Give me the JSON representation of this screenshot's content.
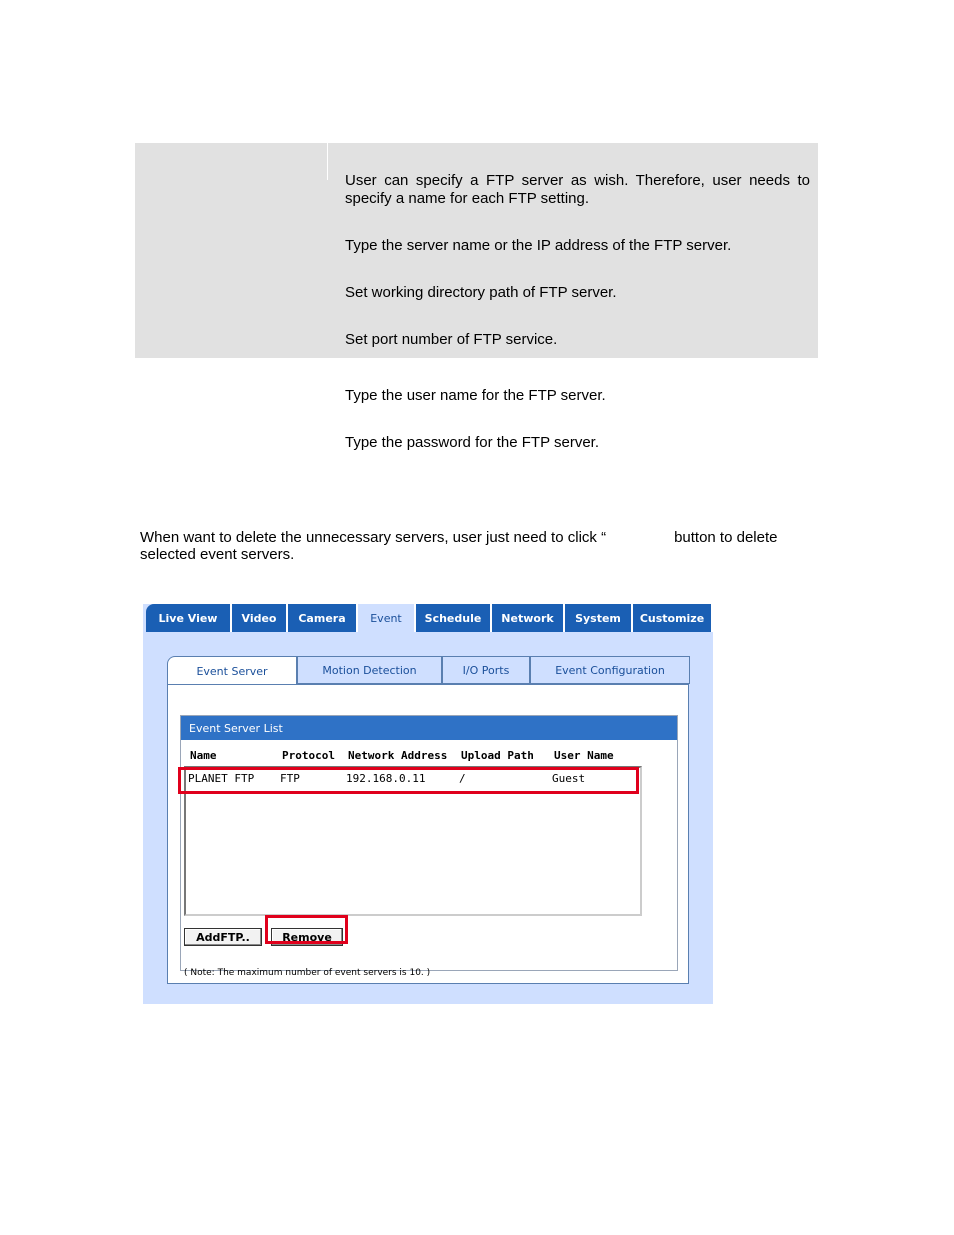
{
  "descriptions": [
    "User can specify a FTP server as wish. Therefore, user needs to specify a name for each FTP setting.",
    "Type the server name or the IP address of the FTP server.",
    "Set working directory path of FTP server.",
    "Set port number of FTP service.",
    "Type the user name for the FTP server.",
    "Type the password for the FTP server."
  ],
  "paragraph": {
    "line1a": "When want to delete the unnecessary servers, user just need to click “",
    "line1b": "button to delete",
    "line2": "selected event servers."
  },
  "screenshot": {
    "nav_tabs": [
      "Live View",
      "Video",
      "Camera",
      "Event",
      "Schedule",
      "Network",
      "System",
      "Customize"
    ],
    "active_tab": "Event",
    "sub_tabs": [
      "Event Server",
      "Motion Detection",
      "I/O Ports",
      "Event Configuration"
    ],
    "active_sub_tab": "Event Server",
    "list_title": "Event Server List",
    "columns": [
      "Name",
      "Protocol",
      "Network Address",
      "Upload Path",
      "User Name"
    ],
    "rows": [
      {
        "name": "PLANET FTP",
        "protocol": "FTP",
        "address": "192.168.0.11",
        "path": "/",
        "user": "Guest"
      }
    ],
    "add_button": "AddFTP..",
    "remove_button": "Remove",
    "note": "( Note: The maximum number of event servers is 10. )",
    "highlight_color": "#e0001c",
    "accent_color": "#1a5fb4"
  }
}
